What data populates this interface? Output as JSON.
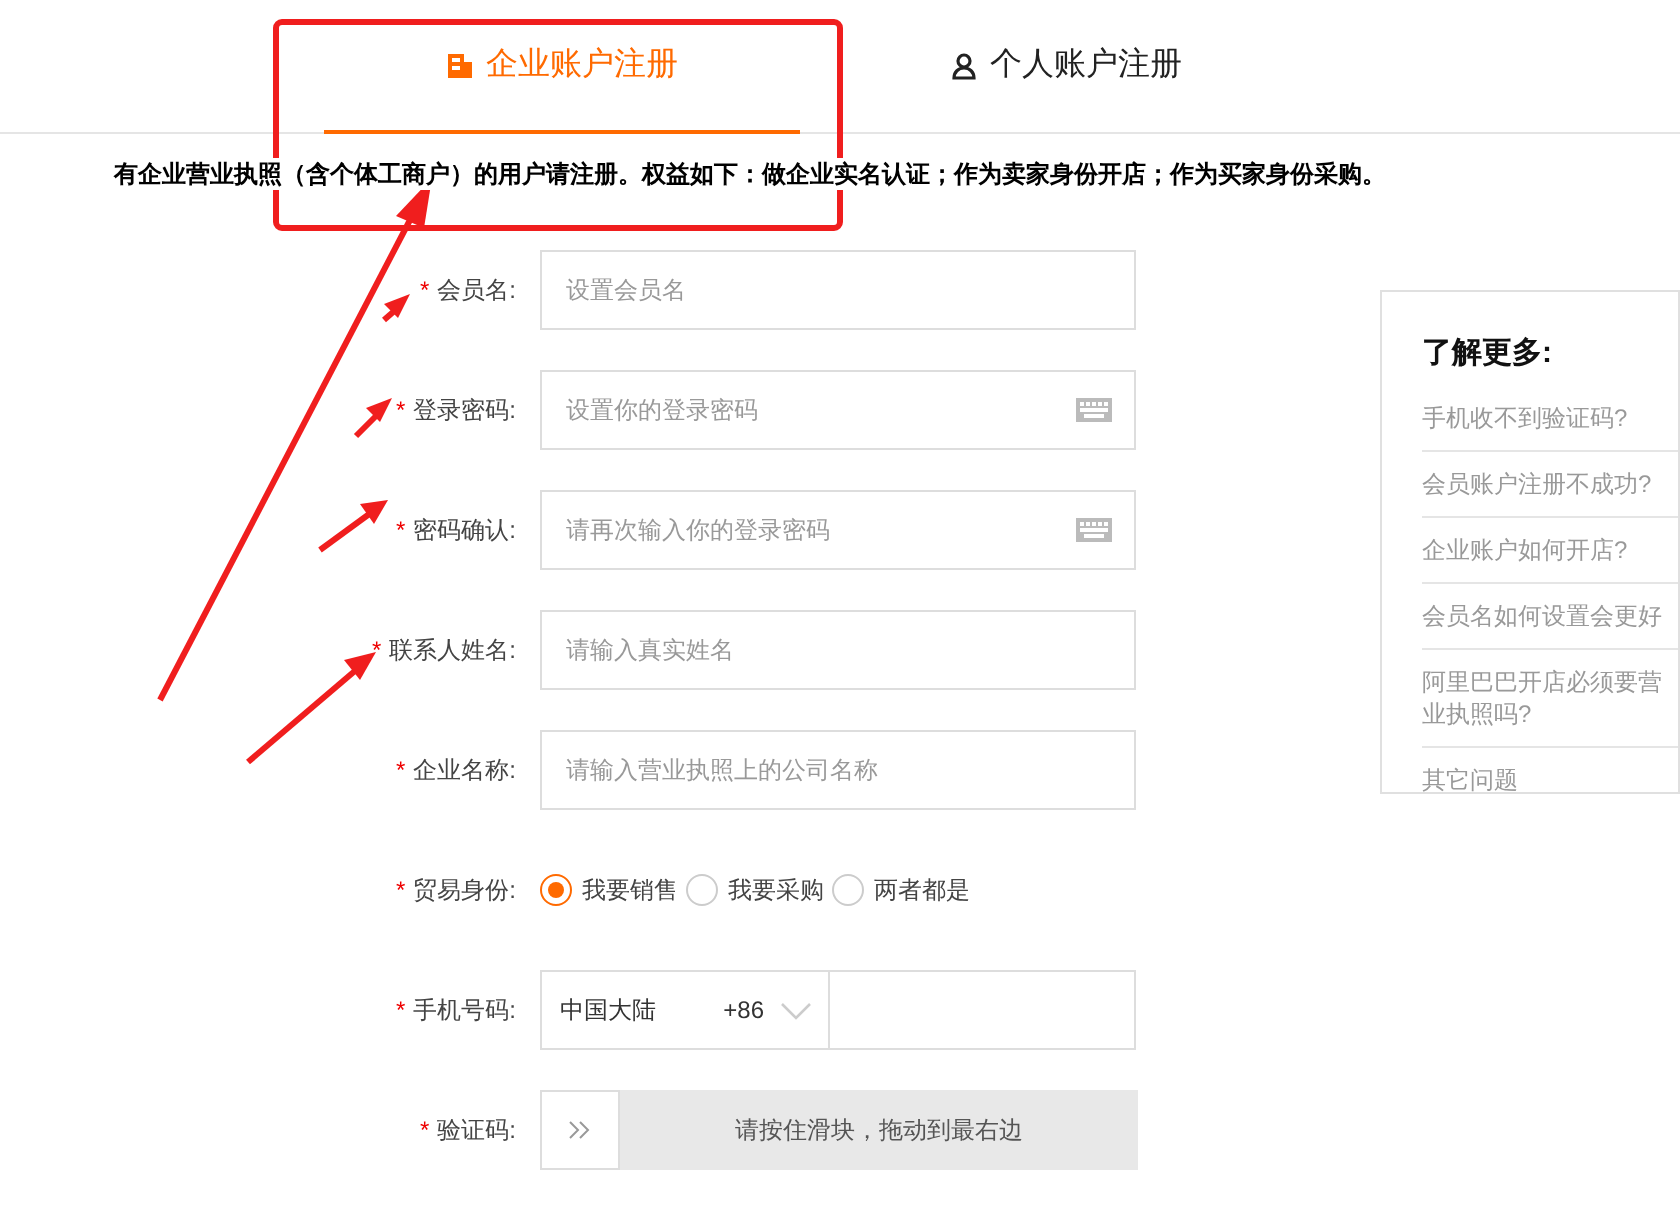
{
  "tabs": [
    {
      "kind": "enterprise",
      "label": "企业账户注册",
      "selected": true
    },
    {
      "kind": "personal",
      "label": "个人账户注册",
      "selected": false
    }
  ],
  "notice": "有企业营业执照（含个体工商户）的用户请注册。权益如下：做企业实名认证；作为卖家身份开店；作为买家身份采购。",
  "fields": [
    {
      "kind": "text",
      "required_mark": "*",
      "label": "会员名:",
      "placeholder": "设置会员名"
    },
    {
      "kind": "password",
      "required_mark": "*",
      "label": "登录密码:",
      "placeholder": "设置你的登录密码"
    },
    {
      "kind": "password",
      "required_mark": "*",
      "label": "密码确认:",
      "placeholder": "请再次输入你的登录密码"
    },
    {
      "kind": "text",
      "required_mark": "*",
      "label": "联系人姓名:",
      "placeholder": "请输入真实姓名"
    },
    {
      "kind": "text",
      "required_mark": "*",
      "label": "企业名称:",
      "placeholder": "请输入营业执照上的公司名称"
    },
    {
      "kind": "radio",
      "required_mark": "*",
      "label": "贸易身份:",
      "options": [
        {
          "label": "我要销售",
          "selected": true
        },
        {
          "label": "我要采购",
          "selected": false
        },
        {
          "label": "两者都是",
          "selected": false
        }
      ]
    },
    {
      "kind": "phone",
      "required_mark": "*",
      "label": "手机号码:",
      "country": "中国大陆",
      "code": "+86"
    },
    {
      "kind": "slider",
      "required_mark": "*",
      "label": "验证码:",
      "hint": "请按住滑块，拖动到最右边"
    }
  ],
  "help": {
    "title": "了解更多:",
    "links": [
      "手机收不到验证码?",
      "会员账户注册不成功?",
      "企业账户如何开店?",
      "会员名如何设置会更好",
      "阿里巴巴开店必须要营业执照吗?",
      "其它问题"
    ]
  }
}
